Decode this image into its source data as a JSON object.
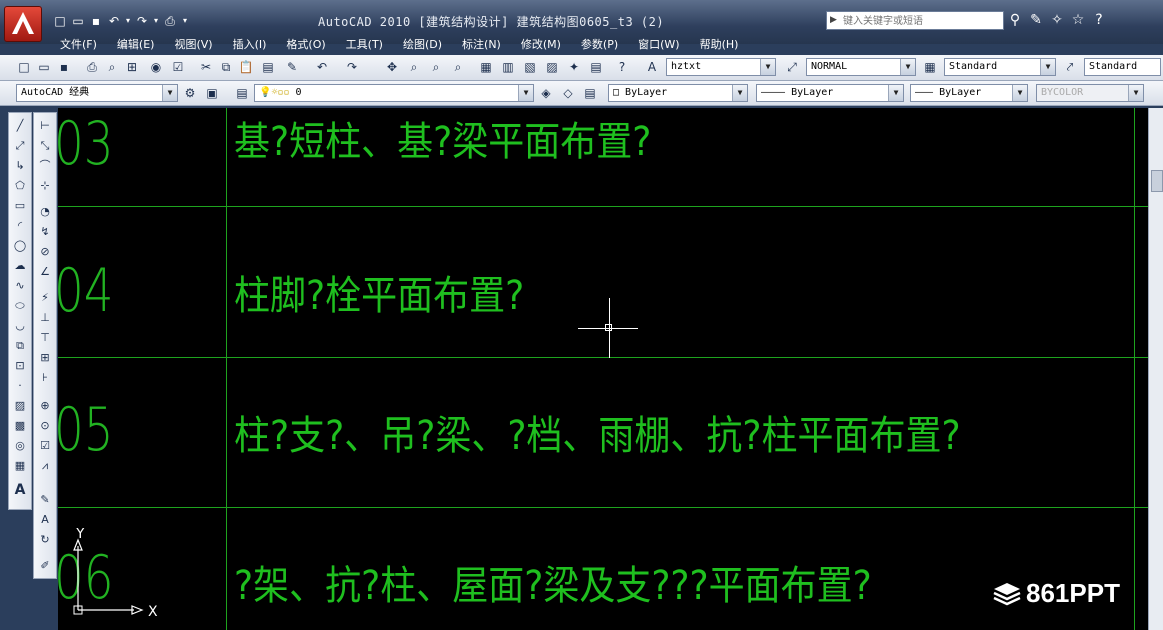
{
  "window": {
    "title": "AutoCAD 2010   [建筑结构设计] 建筑结构图0605_t3 (2)",
    "search_placeholder": "键入关键字或短语"
  },
  "menu": [
    "文件(F)",
    "编辑(E)",
    "视图(V)",
    "插入(I)",
    "格式(O)",
    "工具(T)",
    "绘图(D)",
    "标注(N)",
    "修改(M)",
    "参数(P)",
    "窗口(W)",
    "帮助(H)"
  ],
  "toolbar1": {
    "text_style": "hztxt",
    "dim_style": "NORMAL",
    "table_style": "Standard",
    "multileader_style": "Standard"
  },
  "toolbar2": {
    "workspace": "AutoCAD 经典",
    "layer": "0",
    "color": "ByLayer",
    "linetype": "ByLayer",
    "lineweight": "ByLayer",
    "plotstyle": "BYCOLOR"
  },
  "drawing": {
    "rows": [
      {
        "number": "03",
        "text": "基?短柱、基?梁平面布置?"
      },
      {
        "number": "04",
        "text": "柱脚?栓平面布置?"
      },
      {
        "number": "05",
        "text": "柱?支?、吊?梁、?档、雨棚、抗?柱平面布置?"
      },
      {
        "number": "06",
        "text": "?架、抗?柱、屋面?梁及支???平面布置?"
      }
    ],
    "ucs_y": "Y",
    "ucs_x": "X"
  },
  "colors": {
    "line": "#1ea31e",
    "text": "#1fbf1f",
    "canvas": "#000000"
  },
  "watermark": "861PPT"
}
